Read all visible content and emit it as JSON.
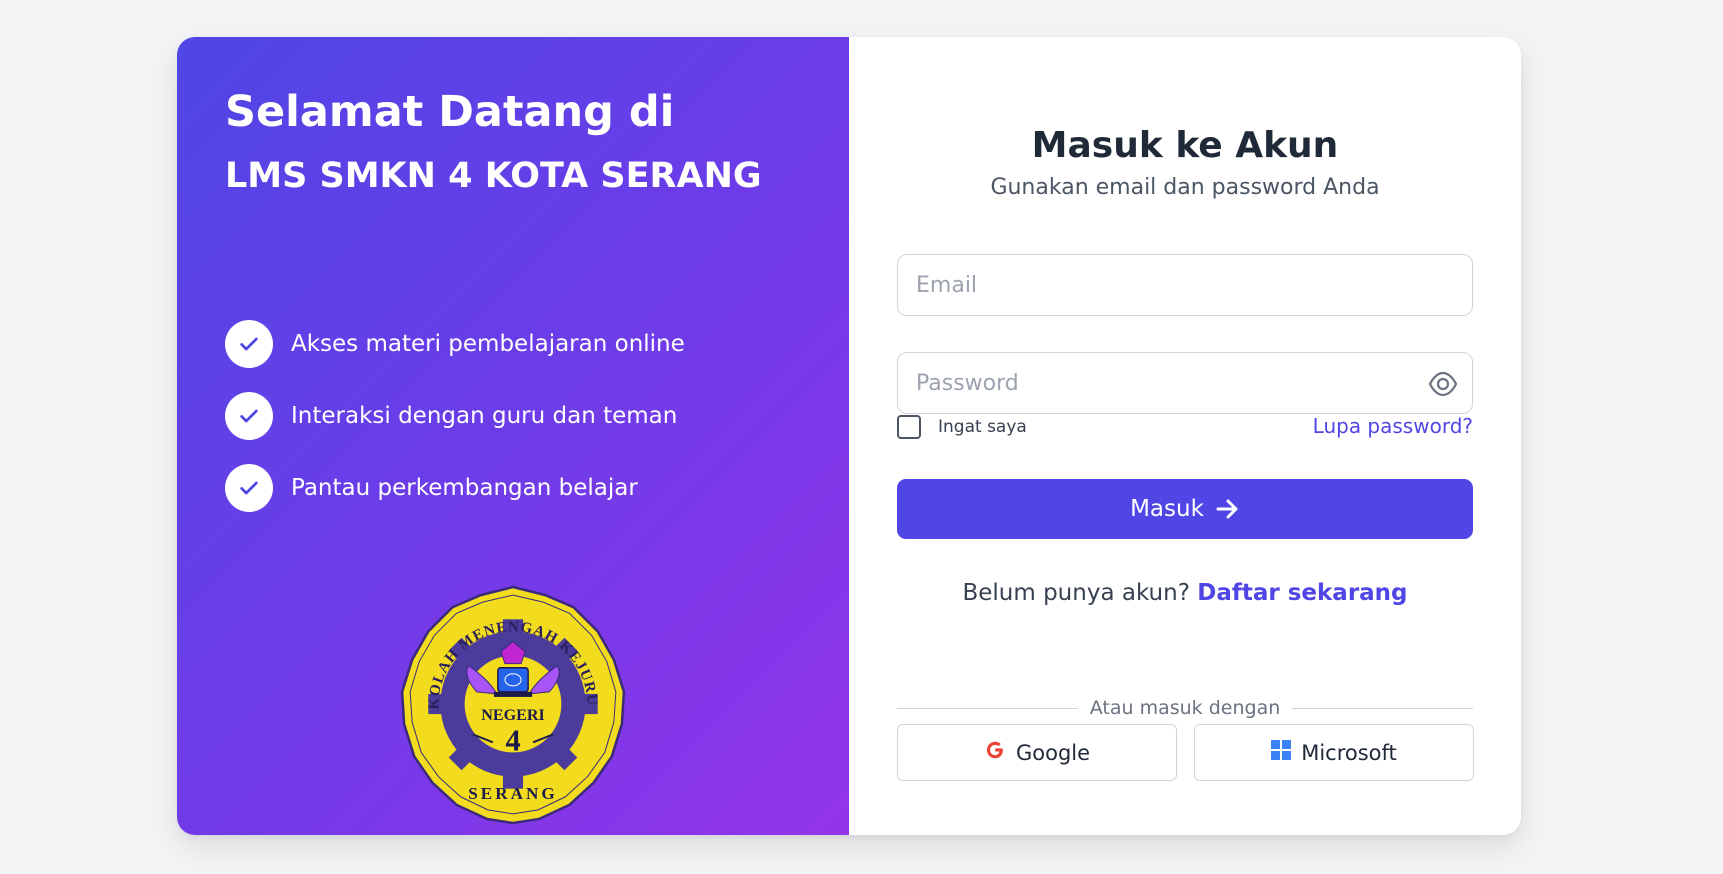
{
  "welcome": {
    "title": "Selamat Datang di",
    "subtitle": "LMS SMKN 4 KOTA SERANG",
    "features": [
      "Akses materi pembelajaran online",
      "Interaksi dengan guru dan teman",
      "Pantau perkembangan belajar"
    ],
    "logo": {
      "top_text": "SEKOLAH MENENGAH KEJURUAN",
      "middle_text": "NEGERI",
      "number": "4",
      "bottom_text": "SERANG"
    }
  },
  "login": {
    "title": "Masuk ke Akun",
    "subtitle": "Gunakan email dan password Anda",
    "email_placeholder": "Email",
    "password_placeholder": "Password",
    "remember_label": "Ingat saya",
    "forgot_link": "Lupa password?",
    "submit_label": "Masuk",
    "signup_prompt": "Belum punya akun?",
    "signup_link": "Daftar sekarang",
    "divider_text": "Atau masuk dengan",
    "google_label": "Google",
    "microsoft_label": "Microsoft"
  },
  "colors": {
    "accent": "#4f46e5",
    "gradient_start": "#4f46e5",
    "gradient_end": "#9333ea",
    "background": "#f3f4f6",
    "logo_yellow": "#f2dc1d"
  },
  "icons": [
    "check-icon",
    "eye-icon",
    "arrow-right-icon",
    "google-icon",
    "microsoft-icon",
    "school-logo"
  ]
}
